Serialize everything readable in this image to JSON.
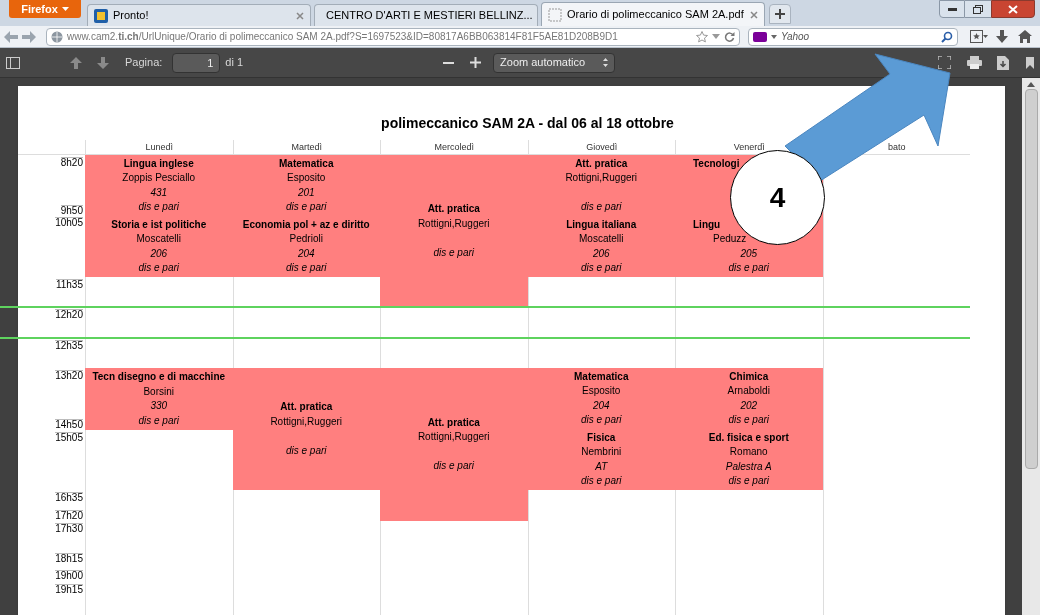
{
  "browser": {
    "menu_button": "Firefox",
    "tabs": [
      {
        "label": "Pronto!",
        "selected": false,
        "kind": "page"
      },
      {
        "label": "CENTRO D'ARTI E MESTIERI BELLINZ...",
        "selected": false,
        "kind": "page"
      },
      {
        "label": "Orario di polimeccanico SAM 2A.pdf",
        "selected": true,
        "kind": "blank"
      }
    ],
    "url": "www.cam2.**ti.ch**/UrlUnique/Orario di polimeccanico SAM 2A.pdf?S=1697523&ID=80817A6BB063814F81F5AE81D208B9D1",
    "search": {
      "placeholder": "Yahoo"
    }
  },
  "viewer": {
    "page_label": "Pagina:",
    "page_value": "1",
    "page_count": "di 1",
    "zoom": "Zoom automatico"
  },
  "timetable": {
    "title": "polimeccanico SAM 2A - dal 06 al 18 ottobre",
    "times": [
      {
        "label": "8h20",
        "kind": "normal"
      },
      {
        "label": "9h50",
        "kind": "normal"
      },
      {
        "label": "10h05",
        "kind": "normal"
      },
      {
        "label": "11h35",
        "kind": "normal"
      },
      {
        "label": "12h20",
        "kind": "break"
      },
      {
        "label": "12h35",
        "kind": "break"
      },
      {
        "label": "13h20",
        "kind": "normal"
      },
      {
        "label": "14h50",
        "kind": "normal"
      },
      {
        "label": "15h05",
        "kind": "normal"
      },
      {
        "label": "16h35",
        "kind": "normal"
      },
      {
        "label": "17h20",
        "kind": "normal"
      },
      {
        "label": "17h30",
        "kind": "normal"
      },
      {
        "label": "18h15",
        "kind": "normal"
      },
      {
        "label": "19h00",
        "kind": "normal"
      },
      {
        "label": "19h15",
        "kind": "normal"
      }
    ],
    "days": [
      {
        "name": "Lunedì",
        "blocks": [
          {
            "lessons": [
              {
                "subject": "Lingua inglese",
                "teacher": "Zoppis Pesciallo",
                "room": "431",
                "note": "dis e pari"
              },
              {
                "subject": "Storia e ist politiche",
                "teacher": "Moscatelli",
                "room": "206",
                "note": "dis e pari"
              }
            ]
          },
          {
            "lessons": [
              {
                "subject": "Tecn disegno e di macchine",
                "teacher": "Borsini",
                "room": "330",
                "note": "dis e pari"
              }
            ]
          }
        ]
      },
      {
        "name": "Martedì",
        "blocks": [
          {
            "lessons": [
              {
                "subject": "Matematica",
                "teacher": "Esposito",
                "room": "201",
                "note": "dis e pari"
              },
              {
                "subject": "Economia pol + az e diritto",
                "teacher": "Pedrioli",
                "room": "204",
                "note": "dis e pari"
              }
            ]
          },
          {
            "lessons": [
              {
                "subject": "Att. pratica",
                "teacher": "Rottigni,Ruggeri",
                "note": "dis e pari"
              }
            ]
          }
        ]
      },
      {
        "name": "Mercoledì",
        "blocks": [
          {
            "lessons": [
              {
                "subject": "Att. pratica",
                "teacher": "Rottigni,Ruggeri",
                "note": "dis e pari"
              }
            ]
          },
          {
            "lessons": [
              {
                "subject": "Att. pratica",
                "teacher": "Rottigni,Ruggeri",
                "note": "dis e pari"
              }
            ]
          }
        ]
      },
      {
        "name": "Giovedì",
        "blocks": [
          {
            "lessons": [
              {
                "subject": "Att. pratica",
                "teacher": "Rottigni,Ruggeri",
                "note": "dis e pari"
              },
              {
                "subject": "Lingua italiana",
                "teacher": "Moscatelli",
                "room": "206",
                "note": "dis e pari"
              }
            ]
          },
          {
            "lessons": [
              {
                "subject": "Matematica",
                "teacher": "Esposito",
                "room": "204",
                "note": "dis e pari"
              },
              {
                "subject": "Fisica",
                "teacher": "Nembrini",
                "room": "AT",
                "note": "dis e pari"
              }
            ]
          }
        ]
      },
      {
        "name": "Venerdì",
        "blocks": [
          {
            "lessons": [
              {
                "subject": "Tecnologi",
                "kind": "covered"
              },
              {
                "subject": "Lingu",
                "teacher": "Peduzz",
                "room": "205",
                "note": "dis e pari",
                "kind": "covered"
              }
            ]
          },
          {
            "lessons": [
              {
                "subject": "Chimica",
                "teacher": "Arnaboldi",
                "room": "202",
                "note": "dis e pari"
              },
              {
                "subject": "Ed. fisica e sport",
                "teacher": "Romano",
                "room": "Palestra A",
                "note": "dis e pari"
              }
            ]
          }
        ]
      },
      {
        "name": "bato"
      }
    ]
  },
  "annotation": {
    "number": "4"
  }
}
